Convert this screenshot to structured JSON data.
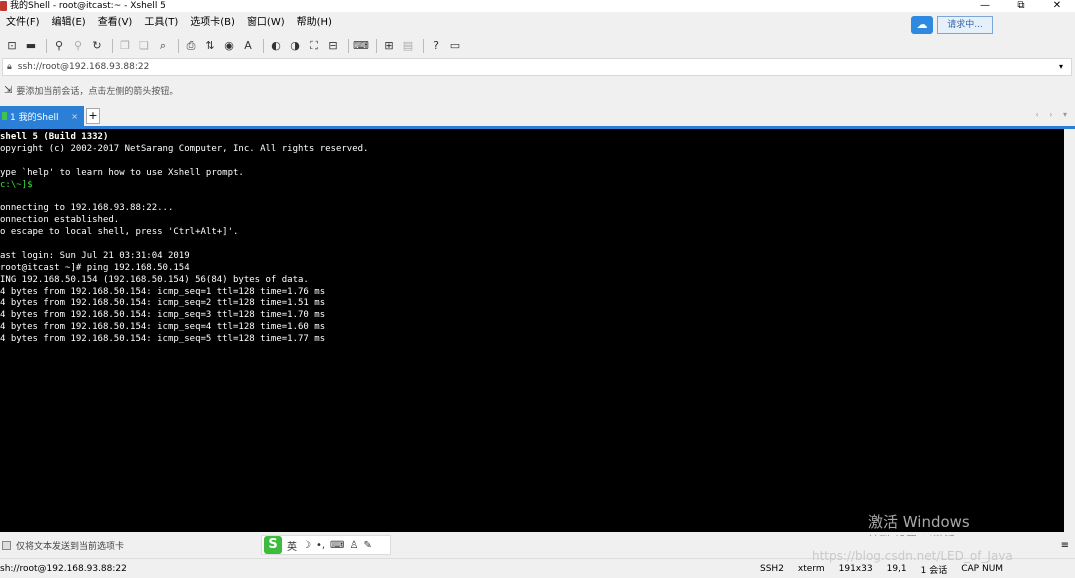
{
  "window": {
    "title": "我的Shell - root@itcast:~ - Xshell 5",
    "minimize": "—",
    "maximize": "⧉",
    "close": "✕"
  },
  "menu": {
    "items": [
      "文件(F)",
      "编辑(E)",
      "查看(V)",
      "工具(T)",
      "选项卡(B)",
      "窗口(W)",
      "帮助(H)"
    ],
    "request_label": "请求中..."
  },
  "toolbar": {
    "icons": [
      "new-session-icon",
      "open-folder-icon",
      "link-icon",
      "unlink-icon",
      "reconnect-icon",
      "copy-icon",
      "paste-icon",
      "find-icon",
      "print-icon",
      "transfer-icon",
      "globe-icon",
      "font-icon",
      "color-scheme-icon",
      "script-icon",
      "fullscreen-icon",
      "lock-icon",
      "keyboard-icon",
      "new-tab-icon",
      "layout-icon",
      "help-icon",
      "chat-icon"
    ]
  },
  "address": {
    "value": "ssh://root@192.168.93.88:22"
  },
  "hint": {
    "text": "要添加当前会话，点击左侧的箭头按钮。"
  },
  "tabs": {
    "active_label": "1 我的Shell",
    "close": "×",
    "add": "+",
    "nav": "‹ › ▾"
  },
  "terminal": {
    "lines": [
      {
        "text": "shell 5 (Build 1332)",
        "style": "bold"
      },
      {
        "text": "opyright (c) 2002-2017 NetSarang Computer, Inc. All rights reserved.",
        "style": ""
      },
      {
        "text": "",
        "style": ""
      },
      {
        "text": "ype `help' to learn how to use Xshell prompt.",
        "style": ""
      },
      {
        "text": "c:\\~]$",
        "style": "green"
      },
      {
        "text": "",
        "style": ""
      },
      {
        "text": "onnecting to 192.168.93.88:22...",
        "style": ""
      },
      {
        "text": "onnection established.",
        "style": ""
      },
      {
        "text": "o escape to local shell, press 'Ctrl+Alt+]'.",
        "style": ""
      },
      {
        "text": "",
        "style": ""
      },
      {
        "text": "ast login: Sun Jul 21 03:31:04 2019",
        "style": ""
      },
      {
        "text": "root@itcast ~]# ping 192.168.50.154",
        "style": ""
      },
      {
        "text": "ING 192.168.50.154 (192.168.50.154) 56(84) bytes of data.",
        "style": ""
      },
      {
        "text": "4 bytes from 192.168.50.154: icmp_seq=1 ttl=128 time=1.76 ms",
        "style": ""
      },
      {
        "text": "4 bytes from 192.168.50.154: icmp_seq=2 ttl=128 time=1.51 ms",
        "style": ""
      },
      {
        "text": "4 bytes from 192.168.50.154: icmp_seq=3 ttl=128 time=1.70 ms",
        "style": ""
      },
      {
        "text": "4 bytes from 192.168.50.154: icmp_seq=4 ttl=128 time=1.60 ms",
        "style": ""
      },
      {
        "text": "4 bytes from 192.168.50.154: icmp_seq=5 ttl=128 time=1.77 ms",
        "style": ""
      }
    ]
  },
  "watermark": {
    "activate_title": "激活 Windows",
    "activate_sub": "转到\"设置\"以激活 Windows。",
    "blog": "https://blog.csdn.net/LED_of_Java"
  },
  "compose": {
    "text": "仅将文本发送到当前选项卡",
    "ime_logo": "S",
    "ime_items": [
      "英",
      "☽",
      "•,",
      "⌨",
      "♙",
      "✎"
    ],
    "menu_icon": "≡"
  },
  "status": {
    "address": "sh://root@192.168.93.88:22",
    "protocol": "SSH2",
    "terminal": "xterm",
    "size": "191x33",
    "position": "19,1",
    "sessions": "1 会话",
    "caps": "CAP NUM"
  }
}
